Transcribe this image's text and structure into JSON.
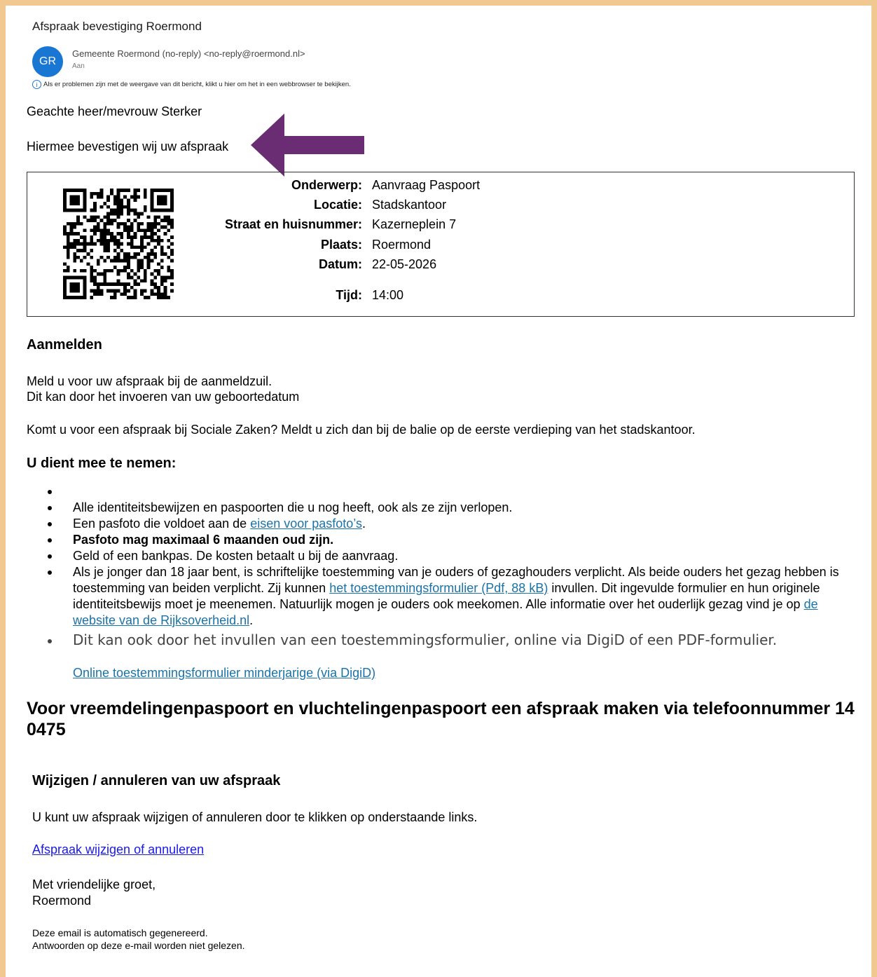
{
  "email": {
    "subject": "Afspraak bevestiging Roermond",
    "avatar_initials": "GR",
    "sender": "Gemeente Roermond (no-reply) <no-reply@roermond.nl>",
    "to_label": "Aan",
    "info_icon": "info-icon",
    "info_text": "Als er problemen zijn met de weergave van dit bericht, klikt u hier om het in een webbrowser te bekijken."
  },
  "body": {
    "greeting": "Geachte heer/mevrouw Sterker",
    "confirm_text": "Hiermee bevestigen wij uw afspraak",
    "arrow_color": "#6a2c72"
  },
  "appointment": {
    "rows": [
      {
        "label": "Onderwerp:",
        "value": "Aanvraag Paspoort"
      },
      {
        "label": "Locatie:",
        "value": "Stadskantoor"
      },
      {
        "label": "Straat en huisnummer:",
        "value": "Kazerneplein 7"
      },
      {
        "label": "Plaats:",
        "value": "Roermond"
      },
      {
        "label": "Datum:",
        "value": "22-05-2026"
      },
      {
        "label": "Tijd:",
        "value": "14:00"
      }
    ]
  },
  "aanmelden": {
    "heading": "Aanmelden",
    "line1": "Meld u voor uw afspraak bij de aanmeldzuil.",
    "line2": "Dit kan door het invoeren van uw geboortedatum",
    "line3": "Komt u voor een afspraak bij Sociale Zaken? Meldt u zich dan bij de balie op de eerste verdieping van het stadskantoor."
  },
  "meenemen": {
    "heading": "U dient mee te nemen:",
    "item1": "Alle identiteitsbewijzen en paspoorten die u nog heeft, ook als ze zijn verlopen.",
    "item2_pre": "Een pasfoto die voldoet aan de ",
    "item2_link": "eisen voor pasfoto’s",
    "item2_post": ".",
    "item3": "Pasfoto mag maximaal 6 maanden oud zijn.",
    "item4": "Geld of een bankpas. De kosten betaalt u bij de aanvraag.",
    "item5_a": "Als je jonger dan 18 jaar bent, is schriftelijke toestemming van je ouders of gezaghouders verplicht. Als beide ouders het gezag hebben is toestemming van beiden verplicht. Zij kunnen ",
    "item5_link1": "het toestemmingsformulier (Pdf, 88 kB)",
    "item5_b": " invullen. Dit ingevulde formulier en hun originele identiteitsbewijs moet je meenemen. Natuurlijk mogen je ouders ook meekomen. Alle informatie over het ouderlijk gezag vind je op ",
    "item5_link2": "de website van de Rijksoverheid.nl",
    "item5_c": ".",
    "item6": "Dit kan ook door het invullen van een toestemmingsformulier, online via DigiD of een PDF-formulier.",
    "item6_link": "Online toestemmingsformulier minderjarige (via DigiD)"
  },
  "notice": {
    "text": "Voor vreemdelingenpaspoort en vluchtelingenpaspoort een afspraak maken via telefoonnummer 14 0475"
  },
  "wijzigen": {
    "heading": "Wijzigen / annuleren van uw afspraak",
    "text": "U kunt uw afspraak wijzigen of annuleren door te klikken op onderstaande links.",
    "link": "Afspraak wijzigen of annuleren",
    "closing1": "Met vriendelijke groet,",
    "closing2": "Roermond",
    "footer1": "Deze email is automatisch gegenereerd.",
    "footer2": "Antwoorden op deze e-mail worden niet gelezen."
  }
}
